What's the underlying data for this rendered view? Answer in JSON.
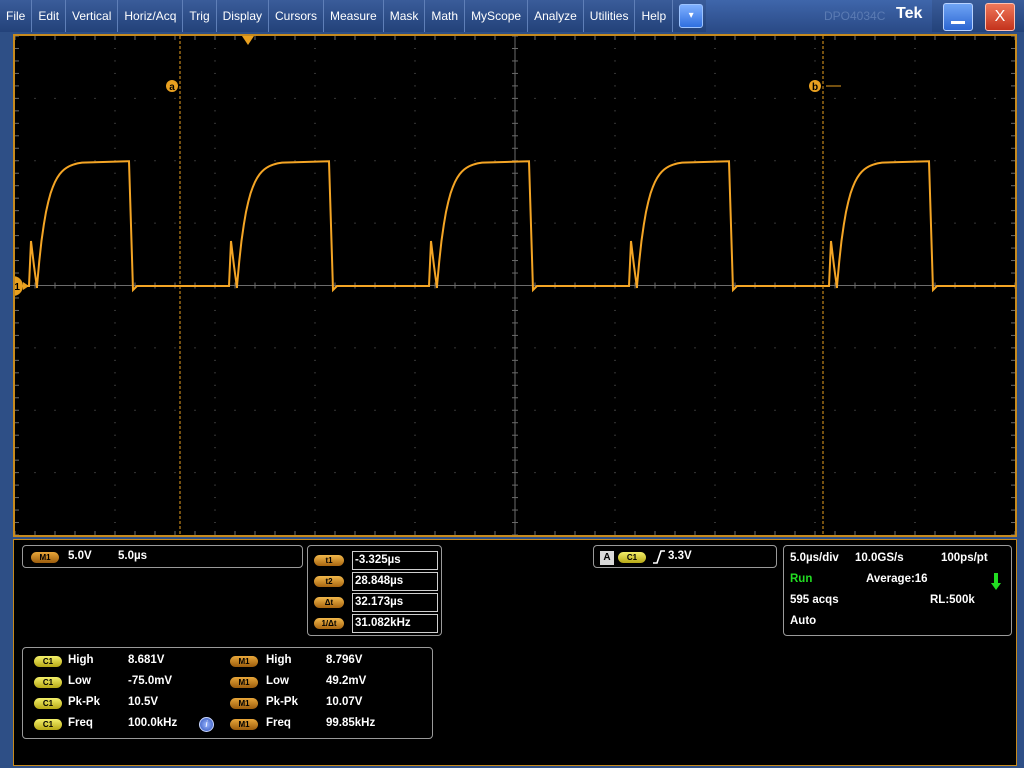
{
  "menu": {
    "items": [
      "File",
      "Edit",
      "Vertical",
      "Horiz/Acq",
      "Trig",
      "Display",
      "Cursors",
      "Measure",
      "Mask",
      "Math",
      "MyScope",
      "Analyze",
      "Utilities",
      "Help"
    ],
    "dropdown_glyph": "▾"
  },
  "window": {
    "brand_faint": "DPO4034C",
    "brand": "Tek",
    "minimize_icon": "minimize-icon",
    "close_label": "X"
  },
  "colors": {
    "trace": "#f4a525",
    "cursor": "#e8a020",
    "graticule": "#6b6b6b",
    "frame": "#c68a1e",
    "run_status": "#22dd22"
  },
  "display": {
    "ground_marker": "M1",
    "cursor_a_label": "a",
    "cursor_b_label": "b",
    "trigger_position_icon": "trigger-position-arrow-icon",
    "graticule_divisions": {
      "horizontal": 10,
      "vertical": 8
    }
  },
  "waveform": {
    "name": "M1",
    "period_us": 10.0,
    "duty_us": 4.8,
    "high_level_div": 2.0,
    "low_level_div": 0.0,
    "start_offset_us": 0.9
  },
  "math_scale": {
    "badge": "M1",
    "volts_per_div": "5.0V",
    "time_per_div": "5.0µs"
  },
  "cursors": [
    {
      "badge": "t1",
      "value": "-3.325µs"
    },
    {
      "badge": "t2",
      "value": "28.848µs"
    },
    {
      "badge": "Δt",
      "value": "32.173µs"
    },
    {
      "badge": "1/Δt",
      "value": "31.082kHz"
    }
  ],
  "trigger": {
    "mode_letter": "A",
    "source": "C1",
    "slope_icon": "rising-edge-icon",
    "level": "3.3V"
  },
  "acquisition": {
    "timebase": "5.0µs/div",
    "sample_rate": "10.0GS/s",
    "resolution": "100ps/pt",
    "state": "Run",
    "mode": "Average:16",
    "acqs": "595 acqs",
    "record_length": "RL:500k",
    "trigger_mode": "Auto"
  },
  "measurements": {
    "left": [
      {
        "badge": "C1",
        "name": "High",
        "value": "8.681V"
      },
      {
        "badge": "C1",
        "name": "Low",
        "value": "-75.0mV"
      },
      {
        "badge": "C1",
        "name": "Pk-Pk",
        "value": "10.5V"
      },
      {
        "badge": "C1",
        "name": "Freq",
        "value": "100.0kHz"
      }
    ],
    "right": [
      {
        "badge": "M1",
        "name": "High",
        "value": "8.796V"
      },
      {
        "badge": "M1",
        "name": "Low",
        "value": "49.2mV"
      },
      {
        "badge": "M1",
        "name": "Pk-Pk",
        "value": "10.07V"
      },
      {
        "badge": "M1",
        "name": "Freq",
        "value": "99.85kHz"
      }
    ],
    "help_icon": "info-icon"
  }
}
